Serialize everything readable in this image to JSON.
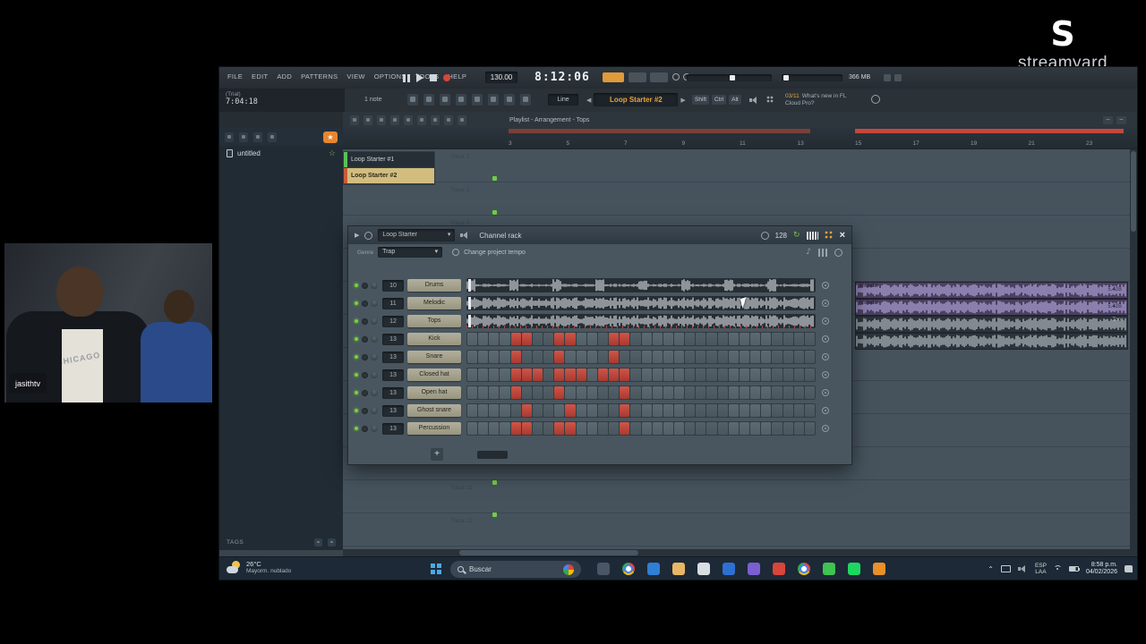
{
  "streamyard": {
    "wordmark": "streamyard"
  },
  "webcam": {
    "username": "jasithtv",
    "shirt_text": "CHICAGO"
  },
  "menu": {
    "items": [
      "FILE",
      "EDIT",
      "ADD",
      "PATTERNS",
      "VIEW",
      "OPTIONS",
      "TOOLS",
      "HELP"
    ]
  },
  "transport": {
    "tempo": "130.00",
    "time": "8:12:06",
    "memory": "366 MB"
  },
  "hint_panel": {
    "line1": "(Trial)",
    "line2": "7:04:18"
  },
  "toolbar2": {
    "note_count": "1 note",
    "snap_mode": "Line",
    "pattern_name": "Loop Starter #2",
    "mod_keys": [
      "Shift",
      "Ctrl",
      "Alt"
    ],
    "promo_badge": "03/11",
    "promo_line1": "What's new in FL",
    "promo_line2": "Cloud Pro?"
  },
  "playlist": {
    "breadcrumb": "Playlist - Arrangement - Tops",
    "ruler_numbers": [
      "3",
      "5",
      "7",
      "9",
      "11",
      "13",
      "15",
      "17",
      "19",
      "21",
      "23"
    ],
    "pattern_picker": [
      {
        "label": "Loop Starter #1",
        "selected": false,
        "chip_color": "#58c257"
      },
      {
        "label": "Loop Starter #2",
        "selected": true,
        "chip_color": "#cc5a3a"
      }
    ],
    "track_labels_top": [
      "Track 1",
      "Track 2",
      "Track 3"
    ],
    "track_labels_bottom": [
      "Track 11",
      "Track 12"
    ],
    "clips": [
      {
        "label": "Melodic",
        "gain": "5.4dB"
      },
      {
        "label": "Melodic",
        "gain": "5.4dB"
      }
    ],
    "tops_clip_label": "Tops"
  },
  "browser": {
    "item_name": "untitled",
    "tags_label": "TAGS"
  },
  "channel_rack": {
    "title": "Channel rack",
    "preset_tab": "Loop Starter",
    "genre_label": "Genre",
    "genre_value": "Trap",
    "tempo_link": "Change project tempo",
    "swing_value": "128",
    "channels": [
      {
        "num": "10",
        "name": "Drums",
        "kind": "wave",
        "wave": "burst"
      },
      {
        "num": "11",
        "name": "Melodic",
        "kind": "wave",
        "wave": "dense"
      },
      {
        "num": "12",
        "name": "Tops",
        "kind": "wave",
        "wave": "dense-ticks"
      },
      {
        "num": "13",
        "name": "Kick",
        "kind": "steps",
        "steps": [
          0,
          0,
          0,
          0,
          1,
          1,
          0,
          0,
          1,
          1,
          0,
          0,
          0,
          1,
          1,
          0,
          0,
          0,
          0,
          0,
          0,
          0,
          0,
          0,
          0,
          0,
          0,
          0,
          0,
          0,
          0,
          0
        ]
      },
      {
        "num": "13",
        "name": "Snare",
        "kind": "steps",
        "steps": [
          0,
          0,
          0,
          0,
          1,
          0,
          0,
          0,
          1,
          0,
          0,
          0,
          0,
          1,
          0,
          0,
          0,
          0,
          0,
          0,
          0,
          0,
          0,
          0,
          0,
          0,
          0,
          0,
          0,
          0,
          0,
          0
        ]
      },
      {
        "num": "13",
        "name": "Closed hat",
        "kind": "steps",
        "steps": [
          0,
          0,
          0,
          0,
          1,
          1,
          1,
          0,
          1,
          1,
          1,
          0,
          1,
          1,
          1,
          0,
          0,
          0,
          0,
          0,
          0,
          0,
          0,
          0,
          0,
          0,
          0,
          0,
          0,
          0,
          0,
          0
        ]
      },
      {
        "num": "13",
        "name": "Open hat",
        "kind": "steps",
        "steps": [
          0,
          0,
          0,
          0,
          1,
          0,
          0,
          0,
          1,
          0,
          0,
          0,
          0,
          0,
          1,
          0,
          0,
          0,
          0,
          0,
          0,
          0,
          0,
          0,
          0,
          0,
          0,
          0,
          0,
          0,
          0,
          0
        ]
      },
      {
        "num": "13",
        "name": "Ghost snare",
        "kind": "steps",
        "steps": [
          0,
          0,
          0,
          0,
          0,
          1,
          0,
          0,
          0,
          1,
          0,
          0,
          0,
          0,
          1,
          0,
          0,
          0,
          0,
          0,
          0,
          0,
          0,
          0,
          0,
          0,
          0,
          0,
          0,
          0,
          0,
          0
        ]
      },
      {
        "num": "13",
        "name": "Percussion",
        "kind": "steps",
        "steps": [
          0,
          0,
          0,
          0,
          1,
          1,
          0,
          0,
          1,
          1,
          0,
          0,
          0,
          0,
          1,
          0,
          0,
          0,
          0,
          0,
          0,
          0,
          0,
          0,
          0,
          0,
          0,
          0,
          0,
          0,
          0,
          0
        ]
      }
    ]
  },
  "taskbar": {
    "weather_temp": "26°C",
    "weather_desc": "Mayorm. nublado",
    "search_placeholder": "Buscar",
    "apps": [
      {
        "name": "file-explorer-icon",
        "color": "#4a5565"
      },
      {
        "name": "chrome-icon",
        "color": "#conic"
      },
      {
        "name": "edge-icon",
        "color": "#2f7fd4"
      },
      {
        "name": "folder-icon",
        "color": "#e8b765"
      },
      {
        "name": "store-icon",
        "color": "#d8dde2"
      },
      {
        "name": "hp-icon",
        "color": "#2f6fd4"
      },
      {
        "name": "discord-icon",
        "color": "#7a5fd0"
      },
      {
        "name": "gmail-icon",
        "color": "#d8453a"
      },
      {
        "name": "browser-icon",
        "color": "#conic"
      },
      {
        "name": "whatsapp-icon",
        "color": "#3fc351"
      },
      {
        "name": "spotify-icon",
        "color": "#1ed760"
      },
      {
        "name": "vlc-icon",
        "color": "#e8902a"
      }
    ],
    "lang_line1": "ESP",
    "lang_line2": "LAA",
    "clock_time": "8:58 p.m.",
    "clock_date": "04/02/2026"
  }
}
